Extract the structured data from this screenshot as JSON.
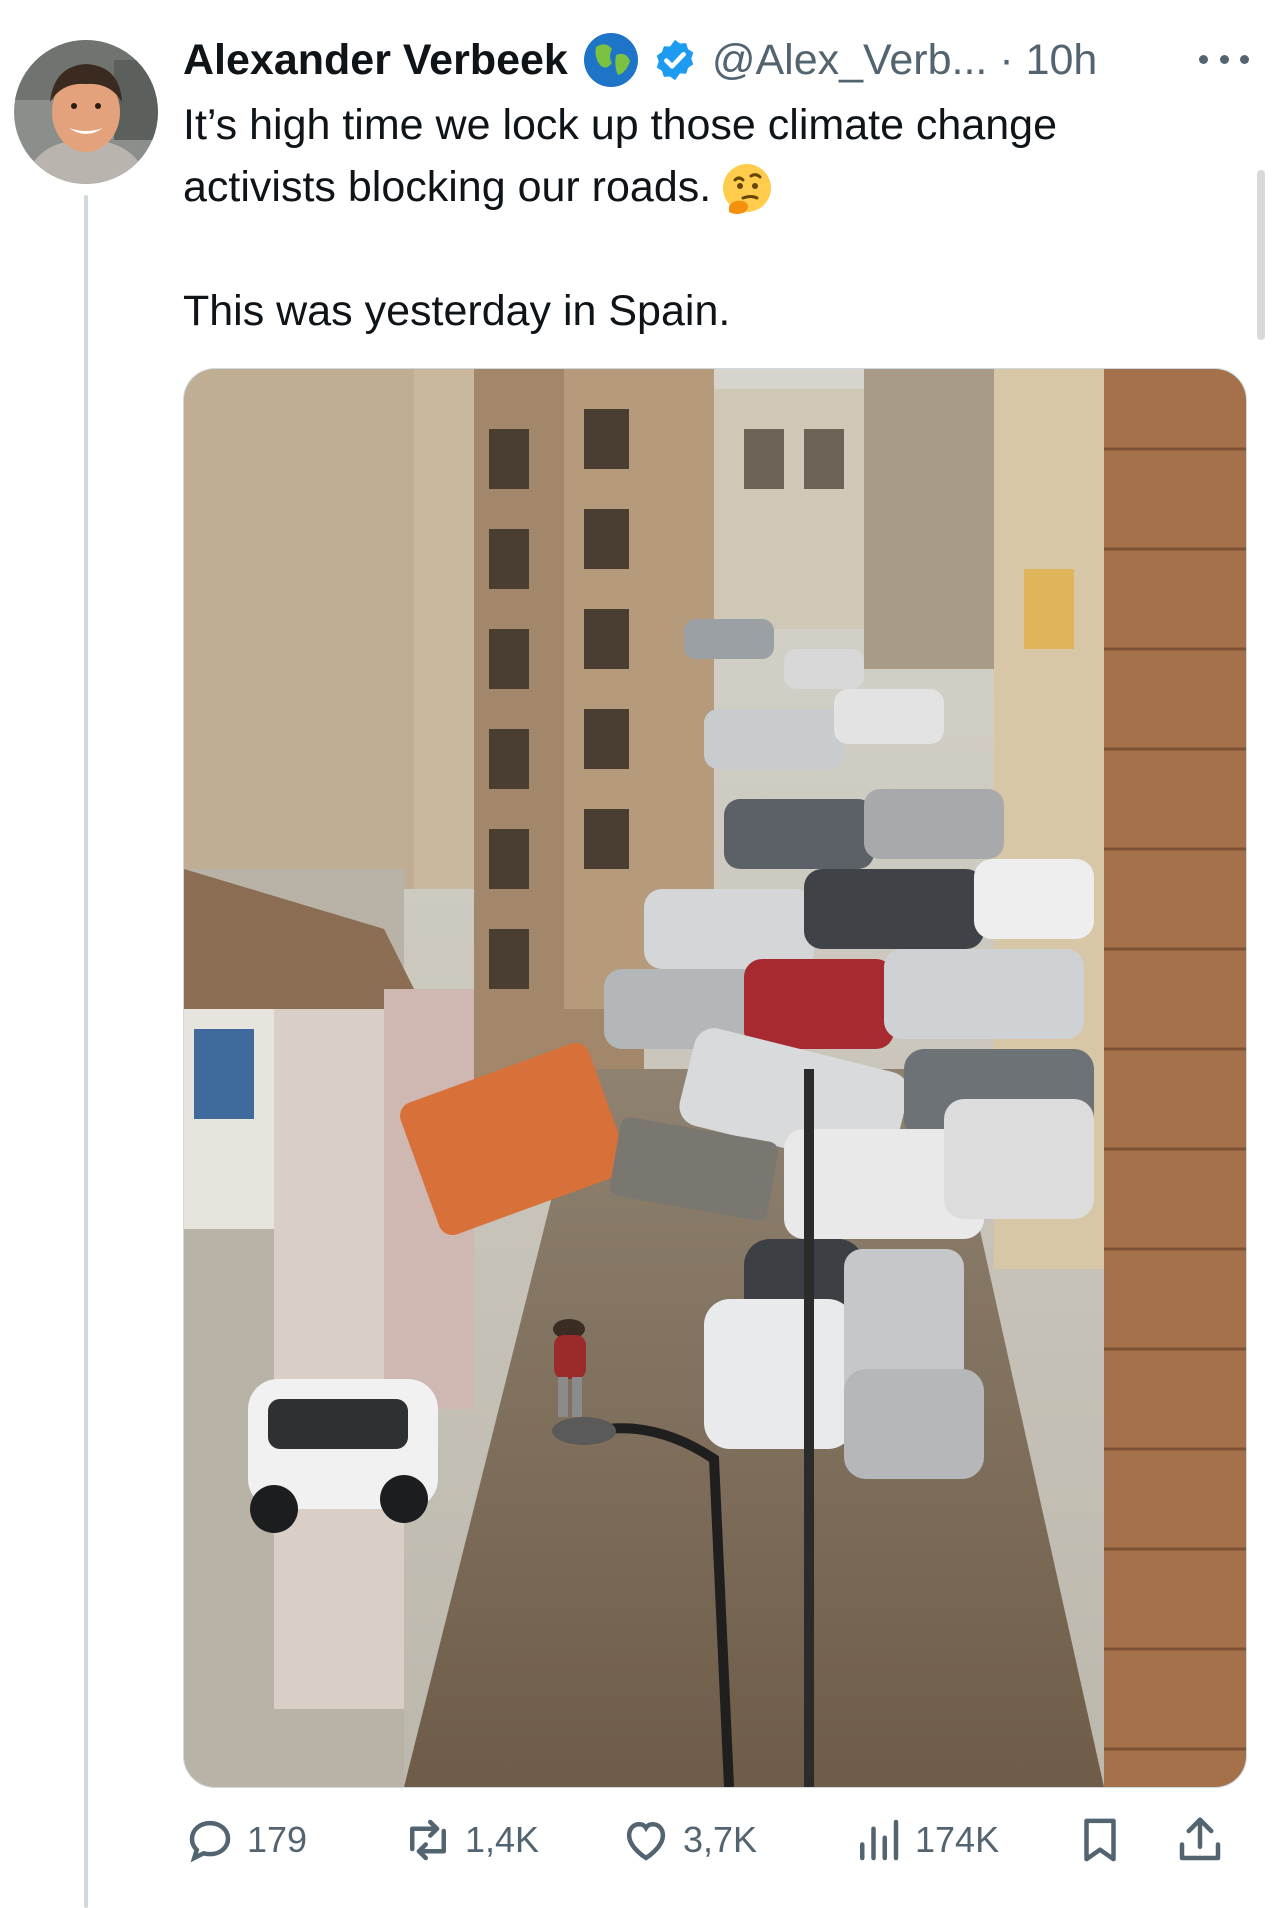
{
  "tweet": {
    "author_name": "Alexander Verbeek",
    "handle": "@Alex_Verb...",
    "separator": "·",
    "time": "10h",
    "badges": [
      "globe-emoji",
      "verified-badge"
    ],
    "text_lines": [
      "It’s high time we lock up those climate change",
      "activists blocking our roads."
    ],
    "text_emoji": "thinking-face-emoji",
    "text_line3": "This was yesterday in Spain."
  },
  "actions": {
    "replies": "179",
    "reposts": "1,4K",
    "likes": "3,7K",
    "views": "174K"
  },
  "icons": {
    "reply": "speech-bubble-icon",
    "repost": "repost-arrows-icon",
    "like": "heart-icon",
    "views": "bar-chart-icon",
    "bookmark": "bookmark-icon",
    "share": "share-upload-icon",
    "more": "more-dots-icon"
  },
  "colors": {
    "text": "#0f1419",
    "secondary": "#536471",
    "verified": "#1d9bf0",
    "thread_line": "#cfd9de"
  }
}
